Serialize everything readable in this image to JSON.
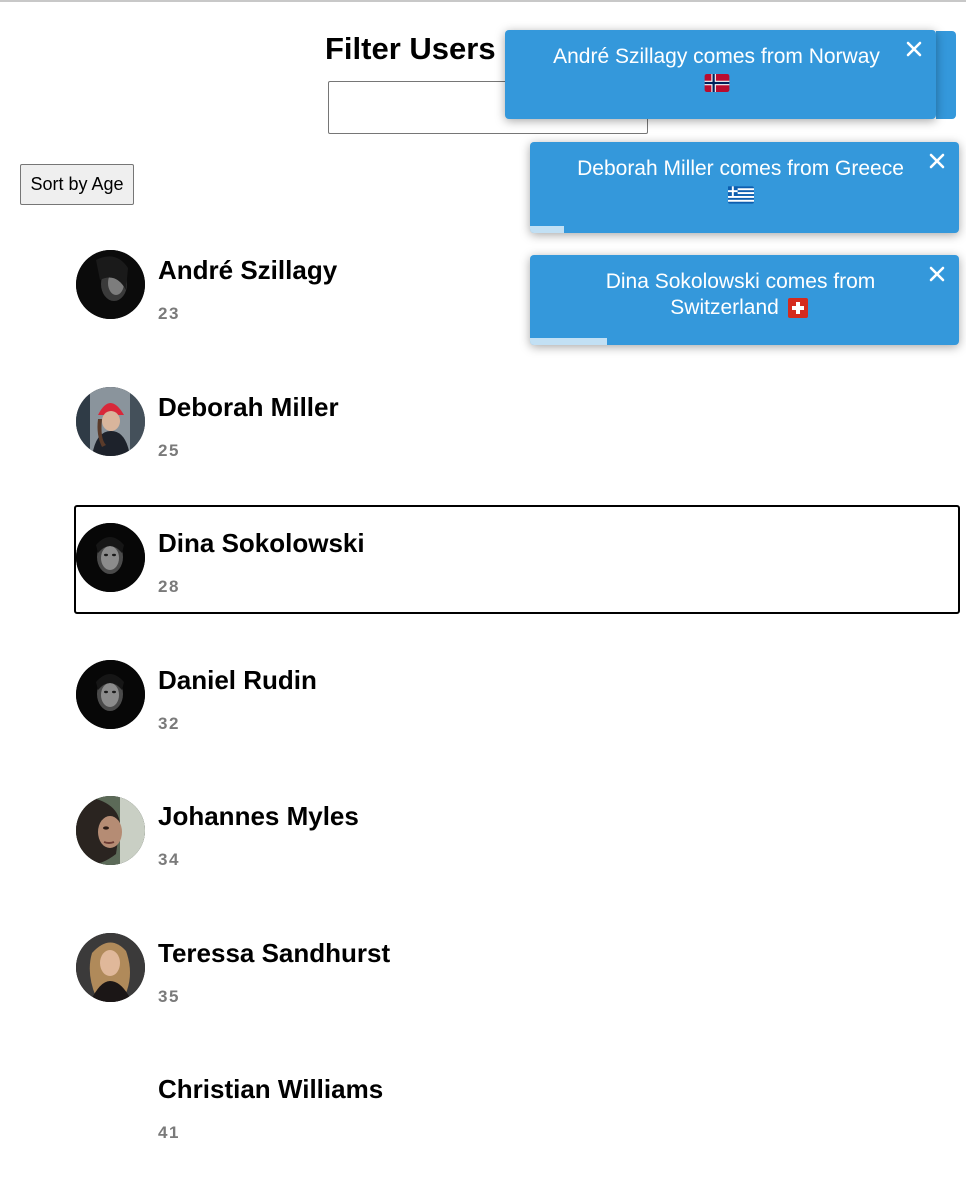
{
  "page": {
    "title": "Filter Users",
    "filter_value": "",
    "sort_button_label": "Sort by Age"
  },
  "users": [
    {
      "name": "André Szillagy",
      "age": "23",
      "avatar": "portrait-dark-avatar",
      "selected": false
    },
    {
      "name": "Deborah Miller",
      "age": "25",
      "avatar": "portrait-red-beanie-avatar",
      "selected": false
    },
    {
      "name": "Dina Sokolowski",
      "age": "28",
      "avatar": "portrait-dark-avatar",
      "selected": true
    },
    {
      "name": "Daniel Rudin",
      "age": "32",
      "avatar": "portrait-dark-avatar",
      "selected": false
    },
    {
      "name": "Johannes Myles",
      "age": "34",
      "avatar": "portrait-profile-avatar",
      "selected": false
    },
    {
      "name": "Teressa Sandhurst",
      "age": "35",
      "avatar": "portrait-blonde-avatar",
      "selected": false
    },
    {
      "name": "Christian Williams",
      "age": "41",
      "avatar": "blank-avatar",
      "selected": false
    }
  ],
  "toasts": [
    {
      "line1": "André Szillagy comes from Norway",
      "line2": "",
      "flag": "norway-flag-icon",
      "close_icon": "close-icon",
      "progress": 0.0
    },
    {
      "line1": "Deborah Miller comes from Greece",
      "line2": "",
      "flag": "greece-flag-icon",
      "close_icon": "close-icon",
      "progress": 0.08
    },
    {
      "line1": "Dina Sokolowski comes from",
      "line2": "Switzerland",
      "flag": "switzerland-flag-icon",
      "close_icon": "close-icon",
      "progress": 0.18
    }
  ],
  "colors": {
    "toast_background": "#3498db",
    "age_text": "#7a7a7a",
    "selected_border": "#000000"
  }
}
